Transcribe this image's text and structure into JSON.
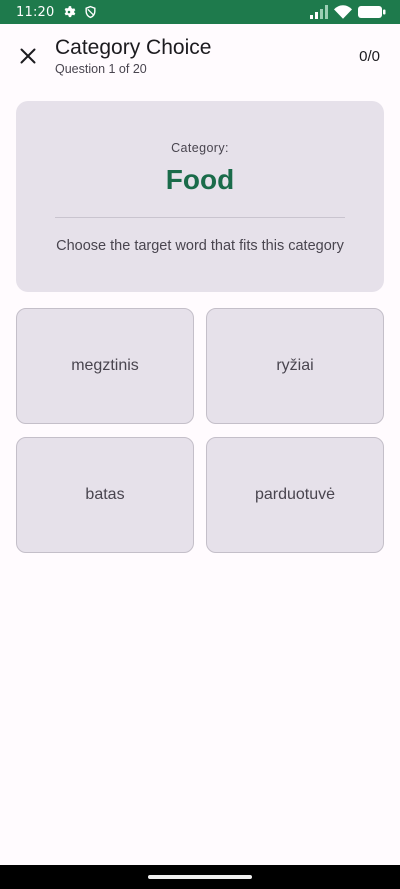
{
  "status_bar": {
    "time": "11:20",
    "left_icons": [
      "settings-icon",
      "shield-icon"
    ],
    "right_icons": [
      "signal-icon",
      "wifi-icon",
      "battery-icon"
    ],
    "background_color": "#1e7a4c"
  },
  "app_bar": {
    "close_icon": "close-icon",
    "title": "Category Choice",
    "subtitle": "Question 1 of 20",
    "score": "0/0"
  },
  "prompt": {
    "label": "Category:",
    "category": "Food",
    "category_color": "#1a6b4a",
    "instruction": "Choose the target word that fits this category"
  },
  "options": [
    {
      "label": "megztinis"
    },
    {
      "label": "ryžiai"
    },
    {
      "label": "batas"
    },
    {
      "label": "parduotuvė"
    }
  ]
}
